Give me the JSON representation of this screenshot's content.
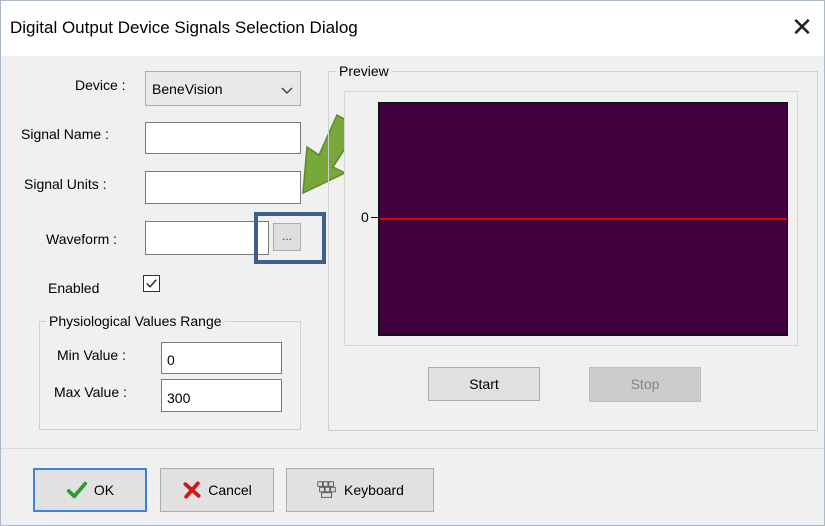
{
  "window": {
    "title": "Digital Output Device Signals Selection Dialog",
    "close_glyph": "✕"
  },
  "form": {
    "device_label": "Device :",
    "device_value": "BeneVision",
    "signal_name_label": "Signal Name :",
    "signal_name_value": "",
    "signal_units_label": "Signal Units :",
    "signal_units_value": "",
    "waveform_label": "Waveform :",
    "waveform_value": "",
    "browse_label": "...",
    "enabled_label": "Enabled",
    "enabled_checked": true
  },
  "range": {
    "group_title": "Physiological Values Range",
    "min_label": "Min Value :",
    "min_value": "0",
    "max_label": "Max Value :",
    "max_value": "300"
  },
  "preview": {
    "group_title": "Preview",
    "y_axis_label": "0",
    "plot_bg": "#400040",
    "line_color": "#e00000",
    "start_label": "Start",
    "stop_label": "Stop"
  },
  "footer": {
    "ok_label": "OK",
    "cancel_label": "Cancel",
    "keyboard_label": "Keyboard"
  },
  "annotation": {
    "arrow_color": "#78a83a",
    "highlight_color": "#3e5f8a"
  }
}
